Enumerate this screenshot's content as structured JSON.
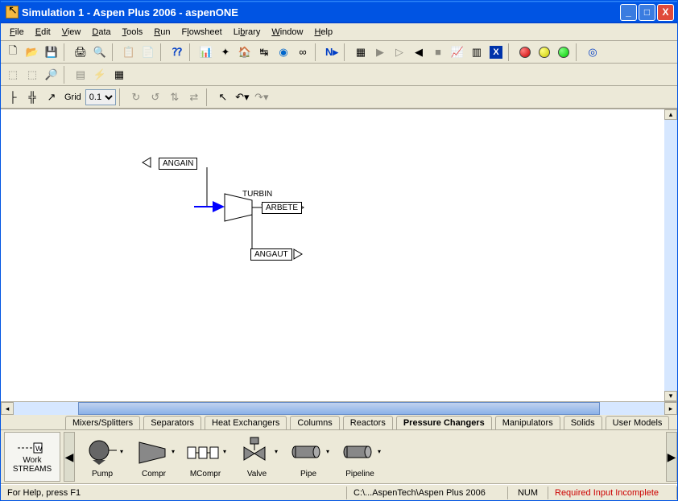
{
  "title": "Simulation 1 - Aspen Plus 2006 - aspenONE",
  "menu": [
    "File",
    "Edit",
    "View",
    "Data",
    "Tools",
    "Run",
    "Flowsheet",
    "Library",
    "Window",
    "Help"
  ],
  "grid_label": "Grid",
  "grid_value": "0.1",
  "flowsheet": {
    "stream1": "ANGAIN",
    "block_label": "TURBIN",
    "stream_out1": "ARBETE",
    "stream_out2": "ANGAUT"
  },
  "tabs": [
    "Mixers/Splitters",
    "Separators",
    "Heat Exchangers",
    "Columns",
    "Reactors",
    "Pressure Changers",
    "Manipulators",
    "Solids",
    "User Models"
  ],
  "active_tab": 5,
  "palette_items": [
    "Pump",
    "Compr",
    "MCompr",
    "Valve",
    "Pipe",
    "Pipeline"
  ],
  "streams_top": "Work",
  "streams_bottom": "STREAMS",
  "status": {
    "help": "For Help, press F1",
    "path": "C:\\...AspenTech\\Aspen Plus 2006",
    "num": "NUM",
    "required": "Required Input Incomplete"
  }
}
